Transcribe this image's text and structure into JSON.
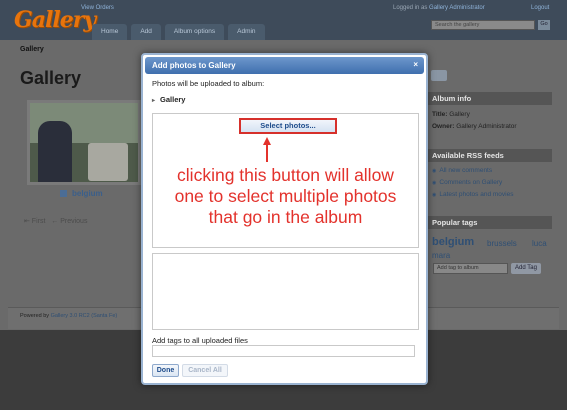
{
  "header": {
    "logo_text": "Gallery",
    "view_orders": "View Orders",
    "nav_tabs": [
      "Home",
      "Add",
      "Album options",
      "Admin"
    ],
    "logged_in_prefix": "Logged in as",
    "logged_in_user": "Gallery Administrator",
    "logout": "Logout",
    "search_placeholder": "Search the gallery",
    "search_button": "Go"
  },
  "breadcrumb": "Gallery",
  "page_title": "Gallery",
  "album": {
    "label": "belgium"
  },
  "pager": {
    "first": "⇤ First",
    "previous": "← Previous"
  },
  "sidebar": {
    "album_info": {
      "heading": "Album info",
      "title_label": "Title:",
      "title_value": "Gallery",
      "owner_label": "Owner:",
      "owner_value": "Gallery Administrator"
    },
    "rss": {
      "heading": "Available RSS feeds",
      "links": [
        "All new comments",
        "Comments on Gallery",
        "Latest photos and movies"
      ]
    },
    "popular_tags": {
      "heading": "Popular tags",
      "tags": [
        "belgium",
        "brussels",
        "luca",
        "mara"
      ],
      "add_placeholder": "Add tag to album",
      "add_button": "Add Tag"
    }
  },
  "footer": {
    "prefix": "Powered by",
    "product": "Gallery 3.0 RC2 (Santa Fe)"
  },
  "dialog": {
    "title": "Add photos to Gallery",
    "close_icon": "×",
    "upload_info": "Photos will be uploaded to album:",
    "album_crumb": "Gallery",
    "select_button": "Select photos...",
    "annotation_lines": [
      "clicking this button will allow",
      "one to select multiple photos",
      "that go in the album"
    ],
    "tags_label": "Add tags to all uploaded files",
    "done_button": "Done",
    "cancel_button": "Cancel All"
  },
  "colors": {
    "annotation": "#e3322c",
    "dialog_title_bar": "#4a79b8",
    "link": "#2f4f74"
  }
}
